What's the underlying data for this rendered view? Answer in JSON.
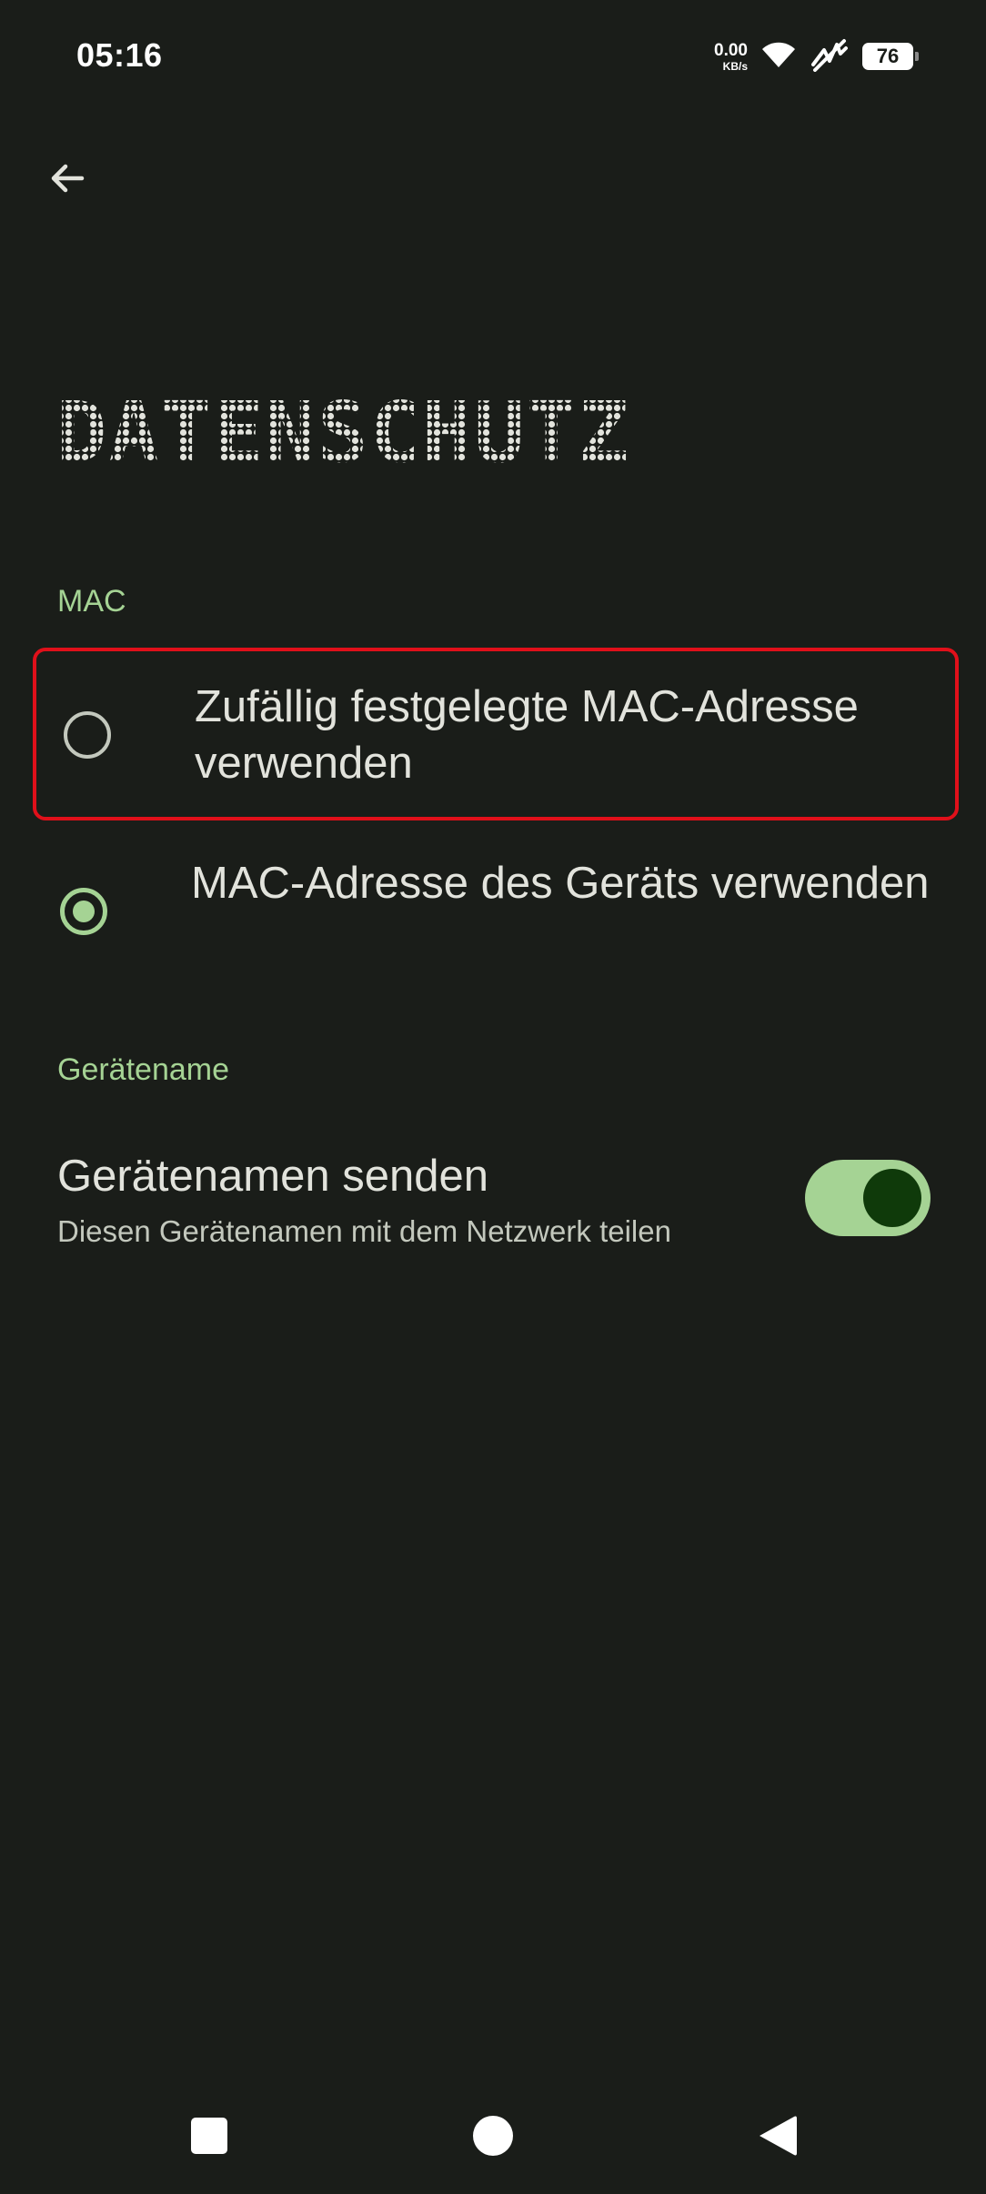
{
  "status_bar": {
    "time": "05:16",
    "net_speed_value": "0.00",
    "net_speed_unit": "KB/s",
    "battery_level": "76",
    "icons": [
      "wifi-icon",
      "mobile-signal-icon",
      "battery-icon"
    ]
  },
  "header": {
    "back_icon": "arrow-left-icon",
    "title": "DATENSCHUTZ"
  },
  "mac_section": {
    "header": "MAC",
    "options": [
      {
        "label": "Zufällig festgelegte MAC-Adresse verwenden",
        "selected": false
      },
      {
        "label": "MAC-Adresse des Geräts verwenden",
        "selected": true
      }
    ]
  },
  "device_name_section": {
    "header": "Gerätename",
    "switch_title": "Gerätenamen senden",
    "switch_summary": "Diesen Gerätenamen mit dem Netzwerk teilen",
    "switch_on": true
  },
  "nav_bar": {
    "buttons": [
      "recents-square-icon",
      "home-circle-icon",
      "back-triangle-icon"
    ]
  },
  "colors": {
    "background": "#1a1d19",
    "accent": "#a5d394",
    "highlight_border": "#e0101a",
    "text_primary": "#e2e3dc",
    "text_secondary": "#c3c8bd"
  }
}
